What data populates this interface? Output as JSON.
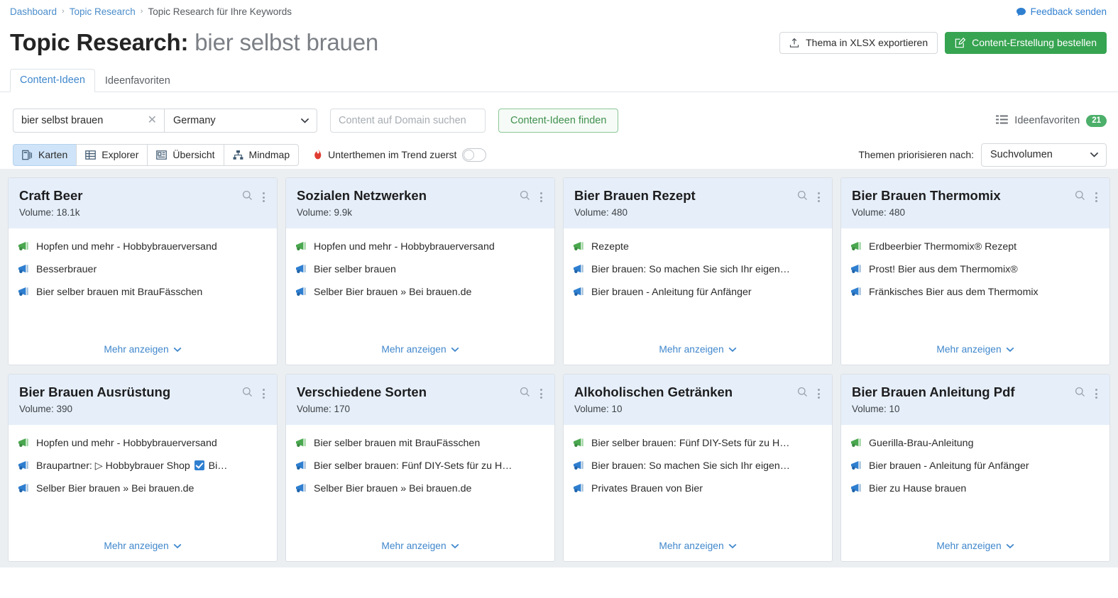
{
  "breadcrumb": {
    "items": [
      "Dashboard",
      "Topic Research",
      "Topic Research für Ihre Keywords"
    ],
    "sep": "›"
  },
  "feedback": {
    "label": "Feedback senden"
  },
  "header": {
    "title_prefix": "Topic Research:",
    "keyword": "bier selbst brauen",
    "export_label": "Thema in XLSX exportieren",
    "order_label": "Content-Erstellung bestellen"
  },
  "tabs": [
    {
      "label": "Content-Ideen",
      "active": true
    },
    {
      "label": "Ideenfavoriten",
      "active": false
    }
  ],
  "search": {
    "keyword_value": "bier selbst brauen",
    "clear_glyph": "✕",
    "country_value": "Germany",
    "domain_placeholder": "Content auf Domain suchen",
    "find_label": "Content-Ideen finden",
    "favorites_label": "Ideenfavoriten",
    "favorites_count": "21"
  },
  "controls": {
    "views": [
      {
        "label": "Karten",
        "icon": "cards-icon",
        "active": true
      },
      {
        "label": "Explorer",
        "icon": "table-icon",
        "active": false
      },
      {
        "label": "Übersicht",
        "icon": "overview-icon",
        "active": false
      },
      {
        "label": "Mindmap",
        "icon": "mindmap-icon",
        "active": false
      }
    ],
    "trend_label": "Unterthemen im Trend zuerst",
    "trend_on": false,
    "prio_label": "Themen priorisieren nach:",
    "prio_value": "Suchvolumen"
  },
  "card_more_label": "Mehr anzeigen",
  "volume_prefix": "Volume:",
  "colors": {
    "accent_green": "#37a451",
    "accent_blue": "#3f87cc",
    "card_header": "#e6eff9",
    "grid_bg": "#eceff2",
    "badge_green": "#4caf6a"
  },
  "cards": [
    {
      "title": "Craft Beer",
      "volume": "18.1k",
      "ideas": [
        {
          "text": "Hopfen und mehr - Hobbybrauerversand",
          "accent": "green"
        },
        {
          "text": "Besserbrauer",
          "accent": "blue"
        },
        {
          "text": "Bier selber brauen mit BrauFässchen",
          "accent": "blue"
        }
      ]
    },
    {
      "title": "Sozialen Netzwerken",
      "volume": "9.9k",
      "ideas": [
        {
          "text": "Hopfen und mehr - Hobbybrauerversand",
          "accent": "green"
        },
        {
          "text": "Bier selber brauen",
          "accent": "blue"
        },
        {
          "text": "Selber Bier brauen » Bei brauen.de",
          "accent": "blue"
        }
      ]
    },
    {
      "title": "Bier Brauen Rezept",
      "volume": "480",
      "ideas": [
        {
          "text": "Rezepte",
          "accent": "green"
        },
        {
          "text": "Bier brauen: So machen Sie sich Ihr eigen…",
          "accent": "blue"
        },
        {
          "text": "Bier brauen - Anleitung für Anfänger",
          "accent": "blue"
        }
      ]
    },
    {
      "title": "Bier Brauen Thermomix",
      "volume": "480",
      "ideas": [
        {
          "text": "Erdbeerbier Thermomix® Rezept",
          "accent": "green"
        },
        {
          "text": "Prost! Bier aus dem Thermomix®",
          "accent": "blue"
        },
        {
          "text": "Fränkisches Bier aus dem Thermomix",
          "accent": "blue"
        }
      ]
    },
    {
      "title": "Bier Brauen Ausrüstung",
      "volume": "390",
      "ideas": [
        {
          "text": "Hopfen und mehr - Hobbybrauerversand",
          "accent": "green"
        },
        {
          "text": "Braupartner: ▷ Hobbybrauer Shop ☑ Bi…",
          "accent": "blue",
          "has_checkbox": true,
          "pre": "Braupartner: ▷ Hobbybrauer Shop",
          "post": "Bi…"
        },
        {
          "text": "Selber Bier brauen » Bei brauen.de",
          "accent": "blue"
        }
      ]
    },
    {
      "title": "Verschiedene Sorten",
      "volume": "170",
      "ideas": [
        {
          "text": "Bier selber brauen mit BrauFässchen",
          "accent": "green"
        },
        {
          "text": "Bier selber brauen: Fünf DIY-Sets für zu H…",
          "accent": "blue"
        },
        {
          "text": "Selber Bier brauen » Bei brauen.de",
          "accent": "blue"
        }
      ]
    },
    {
      "title": "Alkoholischen Getränken",
      "volume": "10",
      "ideas": [
        {
          "text": "Bier selber brauen: Fünf DIY-Sets für zu H…",
          "accent": "green"
        },
        {
          "text": "Bier brauen: So machen Sie sich Ihr eigen…",
          "accent": "blue"
        },
        {
          "text": "Privates Brauen von Bier",
          "accent": "blue"
        }
      ]
    },
    {
      "title": "Bier Brauen Anleitung Pdf",
      "volume": "10",
      "ideas": [
        {
          "text": "Guerilla-Brau-Anleitung",
          "accent": "green"
        },
        {
          "text": "Bier brauen - Anleitung für Anfänger",
          "accent": "blue"
        },
        {
          "text": "Bier zu Hause brauen",
          "accent": "blue"
        }
      ]
    }
  ]
}
